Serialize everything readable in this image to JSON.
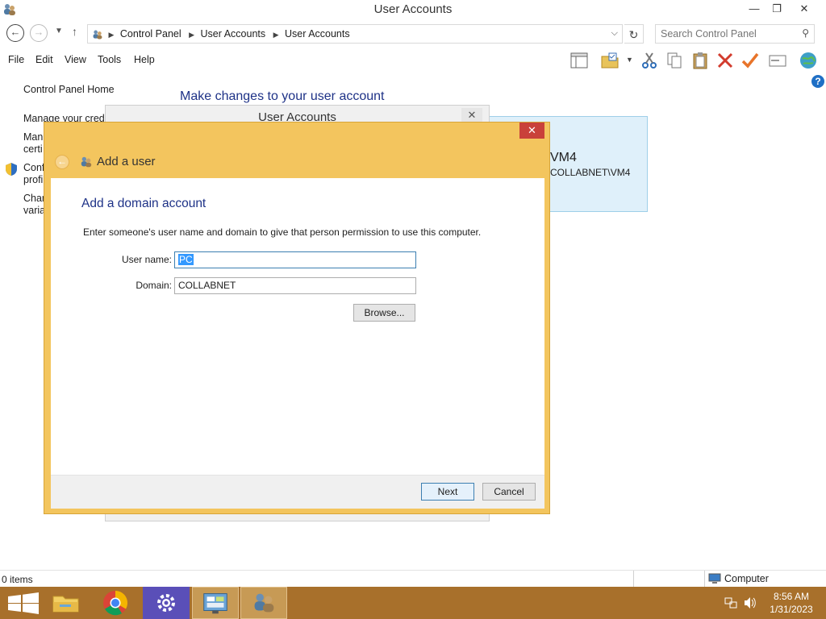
{
  "window": {
    "title": "User Accounts",
    "controls": {
      "minimize": "—",
      "restore": "❐",
      "close": "✕"
    }
  },
  "nav": {
    "back_icon": "arrow-left-icon",
    "forward_icon": "arrow-right-icon",
    "breadcrumbs": [
      "Control Panel",
      "User Accounts",
      "User Accounts"
    ],
    "search_placeholder": "Search Control Panel"
  },
  "menu": {
    "items": [
      "File",
      "Edit",
      "View",
      "Tools",
      "Help"
    ]
  },
  "left_pane": {
    "items": [
      "Control Panel Home",
      "Manage your crede",
      "Man",
      "certi",
      "Conf",
      "profi",
      "Char",
      "varia"
    ]
  },
  "main": {
    "heading": "Make changes to your user account",
    "account_card": {
      "name": "VM4",
      "domain_user": "COLLABNET\\VM4"
    }
  },
  "bg_dialog": {
    "title": "User Accounts",
    "close": "✕"
  },
  "dialog": {
    "title": "Add a user",
    "close": "✕",
    "heading": "Add a domain account",
    "description": "Enter someone's user name and domain to give that person permission to use this computer.",
    "username_label": "User name:",
    "username_value": "PC",
    "domain_label": "Domain:",
    "domain_value": "COLLABNET",
    "browse_label": "Browse...",
    "next_label": "Next",
    "cancel_label": "Cancel"
  },
  "statusbar": {
    "items_text": "0 items",
    "zone_text": "Computer"
  },
  "taskbar": {
    "apps": [
      "start-icon",
      "file-explorer-icon",
      "chrome-icon",
      "settings-icon",
      "control-panel-icon",
      "user-accounts-icon"
    ],
    "time": "8:56 AM",
    "date": "1/31/2023"
  }
}
